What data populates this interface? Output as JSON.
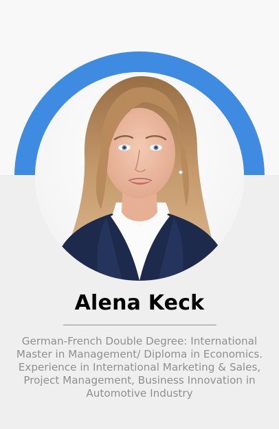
{
  "profile": {
    "name": "Alena Keck",
    "bio": "German-French Double Degree: International Master in Management/ Diploma in Economics. Experience in International Marketing & Sales, Project Management, Business Innovation in Automotive Industry",
    "photo_icon": "portrait-photo"
  },
  "colors": {
    "accent_ring": "#3f8be2",
    "top_background": "#f8f8f8",
    "bottom_background": "#efefef",
    "name_text": "#000000",
    "bio_text": "#8f8f8f"
  }
}
